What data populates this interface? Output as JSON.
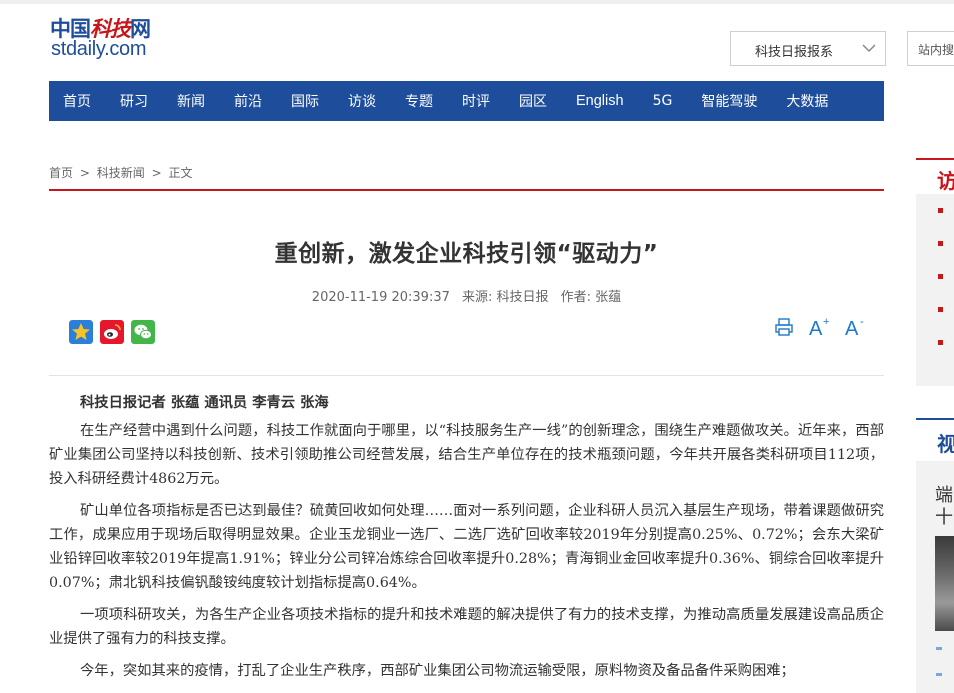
{
  "logo": {
    "cn_prefix": "中国",
    "cn_middle": "科技",
    "cn_suffix": "网",
    "en": "stdaily.com"
  },
  "header": {
    "paper_select": "科技日报报系",
    "site_search_label": "站内搜"
  },
  "nav": {
    "items": [
      "首页",
      "研习",
      "新闻",
      "前沿",
      "国际",
      "访谈",
      "专题",
      "时评",
      "园区",
      "English",
      "5G",
      "智能驾驶",
      "大数据"
    ]
  },
  "breadcrumb": {
    "home": "首页",
    "section": "科技新闻",
    "current": "正文",
    "sep": ">"
  },
  "article": {
    "title": "重创新，激发企业科技引领“驱动力”",
    "datetime": "2020-11-19 20:39:37",
    "source": "来源: 科技日报",
    "author": "作者: 张蕴",
    "byline": "科技日报记者 张蕴 通讯员 李青云 张海",
    "paragraphs": [
      "在生产经营中遇到什么问题，科技工作就面向于哪里，以“科技服务生产一线”的创新理念，围绕生产难题做攻关。近年来，西部矿业集团公司坚持以科技创新、技术引领助推公司经营发展，结合生产单位存在的技术瓶颈问题，今年共开展各类科研项目112项，投入科研经费计4862万元。",
      "矿山单位各项指标是否已达到最佳？硫黄回收如何处理……面对一系列问题，企业科研人员沉入基层生产现场，带着课题做研究工作，成果应用于现场后取得明显效果。企业玉龙铜业一选厂、二选厂选矿回收率较2019年分别提高0.25%、0.72%；会东大梁矿业铅锌回收率较2019年提高1.91%；锌业分公司锌冶炼综合回收率提升0.28%；青海铜业金回收率提升0.36%、铜综合回收率提升0.07%；肃北钒科技偏钒酸铵纯度较计划指标提高0.64%。",
      "一项项科研攻关，为各生产企业各项技术指标的提升和技术难题的解决提供了有力的技术支撑，为推动高质量发展建设高品质企业提供了强有力的科技支撑。",
      "今年，突如其来的疫情，打乱了企业生产秩序，西部矿业集团公司物流运输受限，原料物资及备品备件采购困难；"
    ]
  },
  "sidebar": {
    "section1_title": "访",
    "section2_title": "视",
    "sub1": "端",
    "sub2": "十"
  },
  "colors": {
    "brand_blue": "#1e4e9b",
    "accent_red": "#c8161d",
    "tool_blue": "#1e79c8"
  },
  "icons": [
    "qzone-icon",
    "weibo-icon",
    "wechat-icon",
    "print-icon",
    "font-increase-icon",
    "font-decrease-icon",
    "chevron-down-icon"
  ]
}
